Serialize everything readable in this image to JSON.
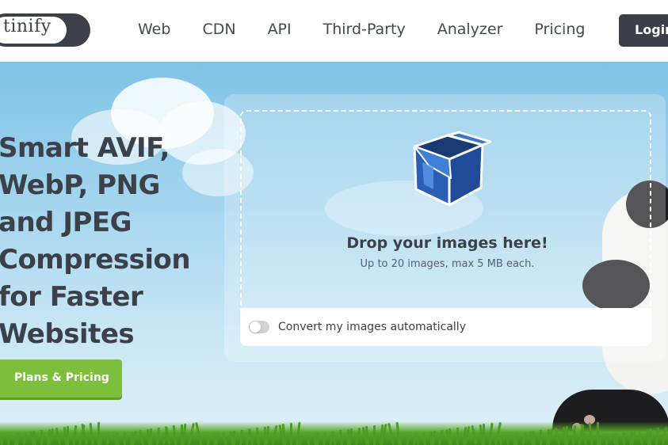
{
  "header": {
    "logo_text": "tinify",
    "nav": [
      "Web",
      "CDN",
      "API",
      "Third-Party",
      "Analyzer",
      "Pricing"
    ],
    "login_label": "Login"
  },
  "hero": {
    "headline_lines": [
      "Smart AVIF,",
      "WebP, PNG",
      "and JPEG",
      "Compression",
      "for Faster",
      "Websites"
    ],
    "cta_label": "Plans & Pricing"
  },
  "dropzone": {
    "title": "Drop your images here!",
    "subtitle": "Up to 20 images, max 5 MB each.",
    "toggle_label": "Convert my images automatically",
    "toggle_on": false,
    "icon": "box-icon"
  },
  "colors": {
    "dark": "#3a3f48",
    "cta_green": "#7dbf3c",
    "sky": "#a2d4ee",
    "box_blue": "#2b5fb3"
  }
}
